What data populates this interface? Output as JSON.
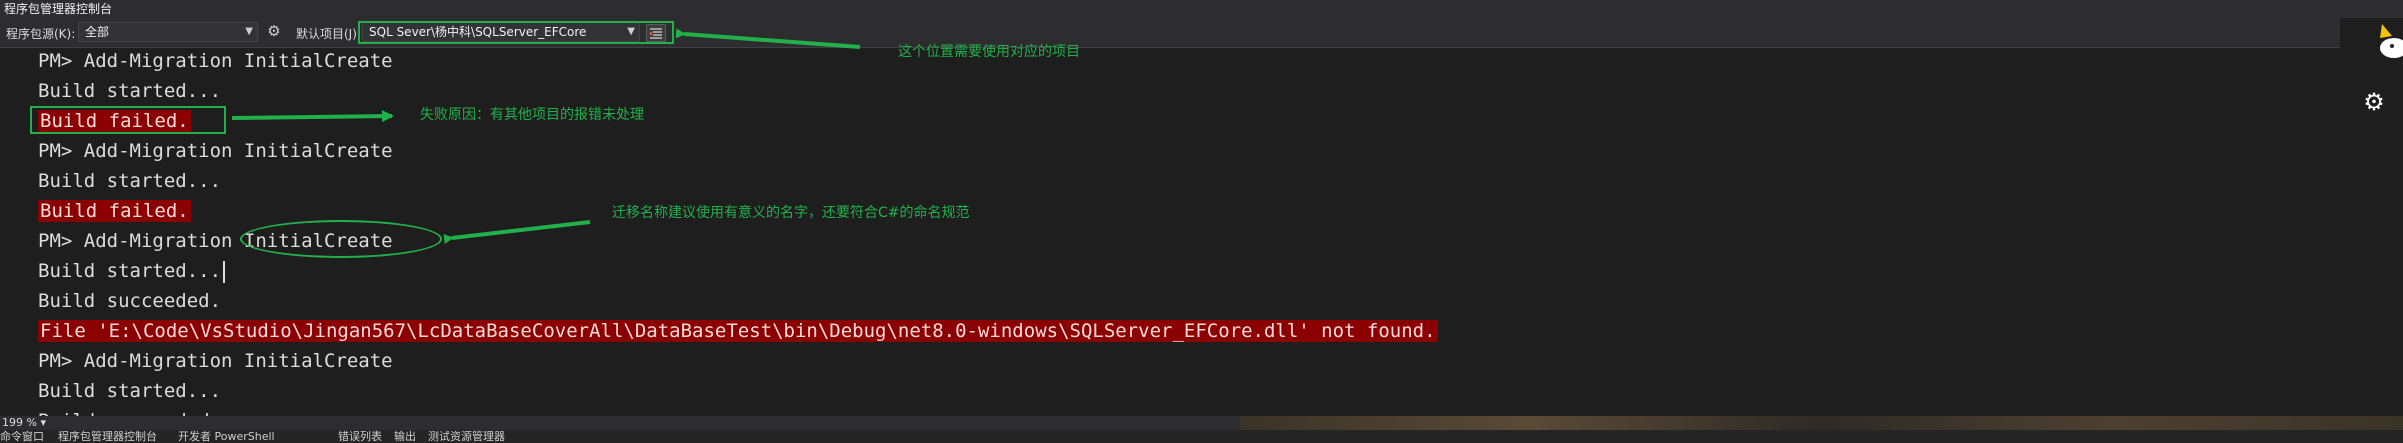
{
  "window": {
    "title": "程序包管理器控制台"
  },
  "toolbar": {
    "source_label": "程序包源(K):",
    "source_value": "全部",
    "project_label": "默认项目(J):",
    "project_value": "SQL Sever\\杨中科\\SQLServer_EFCore"
  },
  "console": {
    "lines": [
      "PM> Add-Migration InitialCreate",
      "Build started...",
      "Build failed.",
      "PM> Add-Migration InitialCreate",
      "Build started...",
      "Build failed.",
      "PM> Add-Migration InitialCreate",
      "Build started...",
      "Build succeeded.",
      "File 'E:\\Code\\VsStudio\\Jingan567\\LcDataBaseCoverAll\\DataBaseTest\\bin\\Debug\\net8.0-windows\\SQLServer_EFCore.dll' not found.",
      "PM> Add-Migration InitialCreate",
      "Build started...",
      "Build succeeded."
    ]
  },
  "annotations": {
    "project_note": "这个位置需要使用对应的项目",
    "fail_reason": "失败原因：有其他项目的报错未处理",
    "naming_note": "迁移名称建议使用有意义的名字，还要符合C#的命名规范"
  },
  "status": {
    "zoom": "199 %"
  },
  "bottom_tabs": [
    "命令窗口",
    "程序包管理器控制台",
    "开发者 PowerShell",
    "错误列表",
    "输出",
    "测试资源管理器"
  ],
  "colors": {
    "accent_green": "#22b04b",
    "error_bg": "#8b0000",
    "background": "#1e1e1e"
  }
}
